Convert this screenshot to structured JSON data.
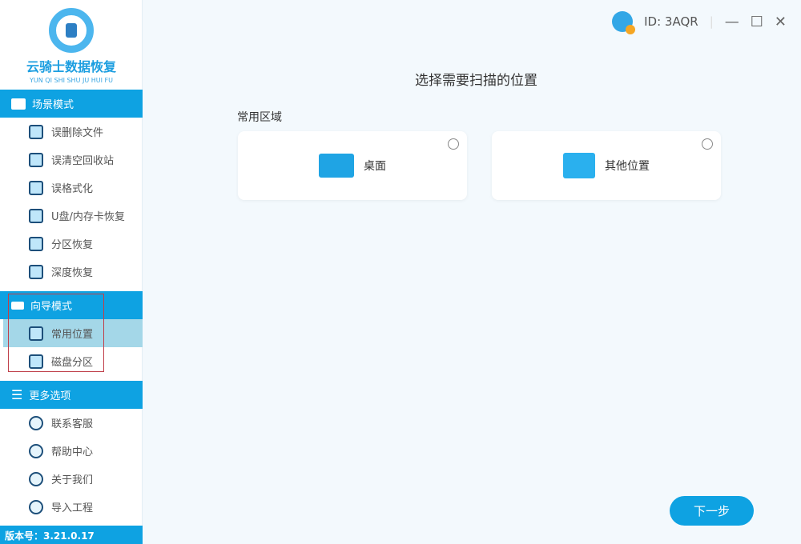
{
  "app": {
    "name_cn": "云骑士数据恢复",
    "name_en": "YUN QI SHI SHU JU HUI FU",
    "version": "版本号：3.21.0.17"
  },
  "header": {
    "user_id": "ID: 3AQR",
    "minimize": "—",
    "maximize": "☐",
    "close": "✕"
  },
  "sidebar": {
    "scene": {
      "label": "场景模式",
      "items": [
        "误删除文件",
        "误清空回收站",
        "误格式化",
        "U盘/内存卡恢复",
        "分区恢复",
        "深度恢复"
      ]
    },
    "guide": {
      "label": "向导模式",
      "items": [
        "常用位置",
        "磁盘分区"
      ]
    },
    "more": {
      "label": "更多选项",
      "items": [
        "联系客服",
        "帮助中心",
        "关于我们",
        "导入工程"
      ]
    }
  },
  "main": {
    "title": "选择需要扫描的位置",
    "section": "常用区域",
    "cards": [
      "桌面",
      "其他位置"
    ],
    "next": "下一步"
  }
}
